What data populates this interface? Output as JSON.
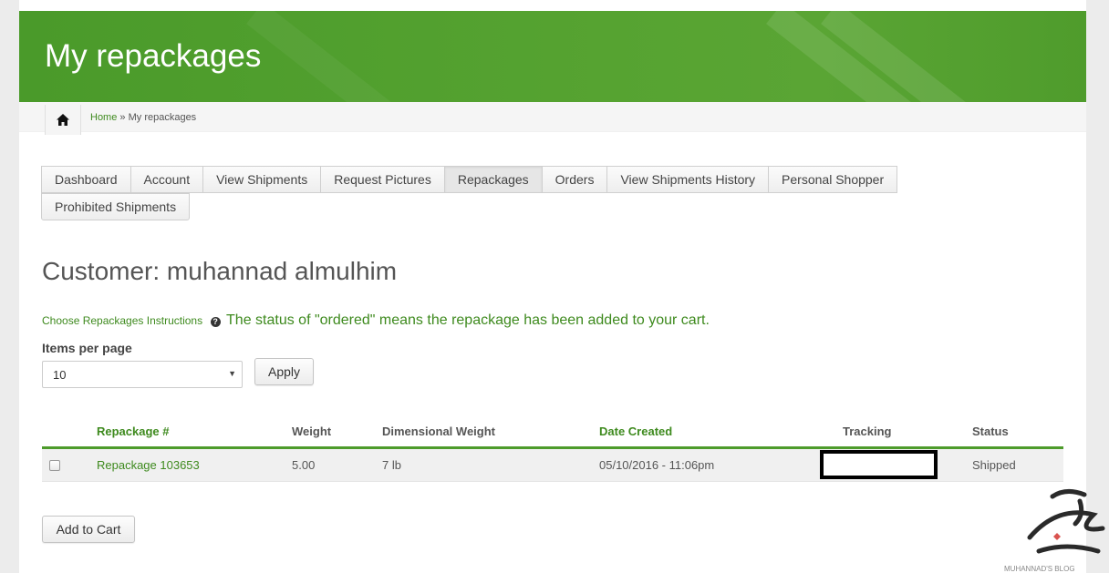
{
  "page": {
    "title": "My repackages"
  },
  "breadcrumb": {
    "home_icon": "home-icon",
    "home_label": "Home",
    "separator": "»",
    "current": "My repackages"
  },
  "tabs": {
    "row1": [
      {
        "label": "Dashboard",
        "active": false
      },
      {
        "label": "Account",
        "active": false
      },
      {
        "label": "View Shipments",
        "active": false
      },
      {
        "label": "Request Pictures",
        "active": false
      },
      {
        "label": "Repackages",
        "active": true
      },
      {
        "label": "Orders",
        "active": false
      },
      {
        "label": "View Shipments History",
        "active": false
      },
      {
        "label": "Personal Shopper",
        "active": false
      }
    ],
    "row2": [
      {
        "label": "Prohibited Shipments",
        "active": false
      }
    ]
  },
  "customer": {
    "heading": "Customer: muhannad almulhim"
  },
  "instructions": {
    "link": "Choose Repackages Instructions",
    "help_icon": "question-circle-icon",
    "note": "The status of \"ordered\" means the repackage has been added to your cart."
  },
  "items_per_page": {
    "label": "Items per page",
    "value": "10",
    "apply_label": "Apply"
  },
  "table": {
    "headers": [
      "",
      "Repackage #",
      "Weight",
      "Dimensional Weight",
      "Date Created",
      "Tracking",
      "Status"
    ],
    "rows": [
      {
        "repackage": "Repackage 103653",
        "weight": "5.00",
        "dim_weight": "7 lb",
        "date": "05/10/2016 - 11:06pm",
        "tracking": "",
        "status": "Shipped"
      }
    ]
  },
  "actions": {
    "add_to_cart": "Add to Cart"
  },
  "watermark": {
    "text": "MUHANNAD'S BLOG"
  },
  "colors": {
    "brand_green": "#56a331",
    "link_green": "#3e8a1e"
  }
}
